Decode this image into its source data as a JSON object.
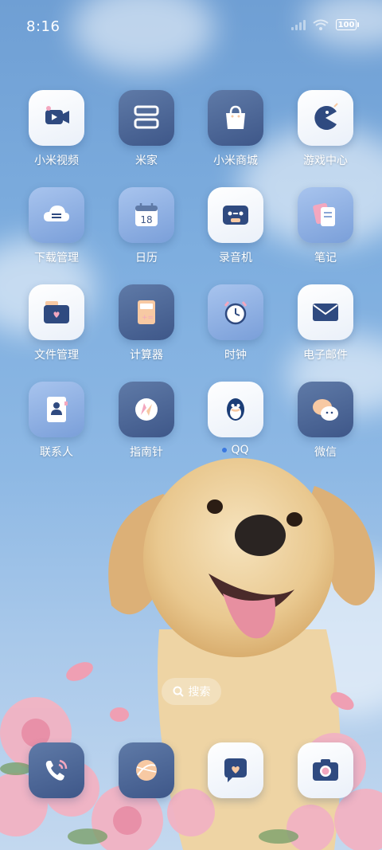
{
  "status_bar": {
    "time": "8:16",
    "battery": "100",
    "icons": [
      "signal-icon",
      "wifi-icon",
      "battery-icon"
    ]
  },
  "apps": [
    {
      "label": "小米视频",
      "icon": "video-camera-icon",
      "style": "light"
    },
    {
      "label": "米家",
      "icon": "mijia-icon",
      "style": "dark"
    },
    {
      "label": "小米商城",
      "icon": "shopping-bag-icon",
      "style": "dark"
    },
    {
      "label": "游戏中心",
      "icon": "pacman-icon",
      "style": "light"
    },
    {
      "label": "下载管理",
      "icon": "cloud-download-icon",
      "style": "mid"
    },
    {
      "label": "日历",
      "icon": "calendar-icon",
      "style": "mid",
      "day": "18"
    },
    {
      "label": "录音机",
      "icon": "tape-recorder-icon",
      "style": "light"
    },
    {
      "label": "笔记",
      "icon": "notes-icon",
      "style": "mid"
    },
    {
      "label": "文件管理",
      "icon": "folder-icon",
      "style": "light"
    },
    {
      "label": "计算器",
      "icon": "calculator-icon",
      "style": "dark"
    },
    {
      "label": "时钟",
      "icon": "alarm-clock-icon",
      "style": "mid"
    },
    {
      "label": "电子邮件",
      "icon": "mail-icon",
      "style": "light"
    },
    {
      "label": "联系人",
      "icon": "contacts-icon",
      "style": "mid"
    },
    {
      "label": "指南针",
      "icon": "compass-icon",
      "style": "dark"
    },
    {
      "label": "QQ",
      "icon": "qq-penguin-icon",
      "style": "light",
      "badge_dot": true
    },
    {
      "label": "微信",
      "icon": "wechat-icon",
      "style": "dark"
    }
  ],
  "search": {
    "label": "搜索"
  },
  "dock": [
    {
      "icon": "phone-icon",
      "style": "dark"
    },
    {
      "icon": "browser-icon",
      "style": "dark"
    },
    {
      "icon": "messages-icon",
      "style": "light"
    },
    {
      "icon": "camera-icon",
      "style": "light"
    }
  ],
  "colors": {
    "accent_dark": "#3e5789",
    "accent_navy": "#2f4a80",
    "pink": "#f3a7bf",
    "peach": "#f7c9a3"
  }
}
